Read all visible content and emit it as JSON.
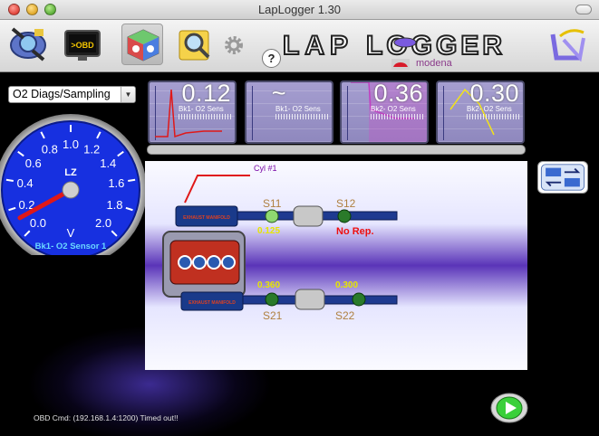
{
  "window": {
    "title": "LapLogger 1.30"
  },
  "toolbar": {
    "buttons": [
      {
        "icon": "diagnostics-icon"
      },
      {
        "icon": "obd-monitor-icon",
        "label": "OBD"
      },
      {
        "icon": "dashboard-cube-icon"
      },
      {
        "icon": "search-icon"
      },
      {
        "icon": "gear-icon"
      }
    ],
    "help_label": "?",
    "logo_text": "LAP LOGGER",
    "profile_name": "modena"
  },
  "mode_select": {
    "value": "O2 Diags/Sampling"
  },
  "gauge": {
    "ticks": [
      "0.0",
      "0.2",
      "0.4",
      "0.6",
      "0.8",
      "1.0",
      "1.2",
      "1.4",
      "1.6",
      "1.8",
      "2.0"
    ],
    "unit": "V",
    "label": "Bk1- O2 Sensor 1",
    "value": 0.12,
    "max": 2.0,
    "face_color": "#1730e0",
    "needle_color": "#e01818"
  },
  "mini_charts": [
    {
      "value": "0.12",
      "label": "Bk1- O2 Sens"
    },
    {
      "value": "~",
      "label": "Bk1- O2 Sens"
    },
    {
      "value": "0.36",
      "label": "Bk2- O2 Sens"
    },
    {
      "value": "0.30",
      "label": "Bk2- O2 Sens"
    }
  ],
  "diagram": {
    "cylinder_label": "Cyl #1",
    "manifold_label": "EXHAUST MANIFOLD",
    "sensors": {
      "s11": {
        "label": "S11",
        "value": "0.125"
      },
      "s12": {
        "label": "S12",
        "value": "No Rep."
      },
      "s21": {
        "label": "S21",
        "value": "0.360"
      },
      "s22": {
        "label": "S22",
        "value": "0.300"
      }
    }
  },
  "status": {
    "text": "OBD Cmd: (192.168.1.4:1200) Timed out!!"
  }
}
